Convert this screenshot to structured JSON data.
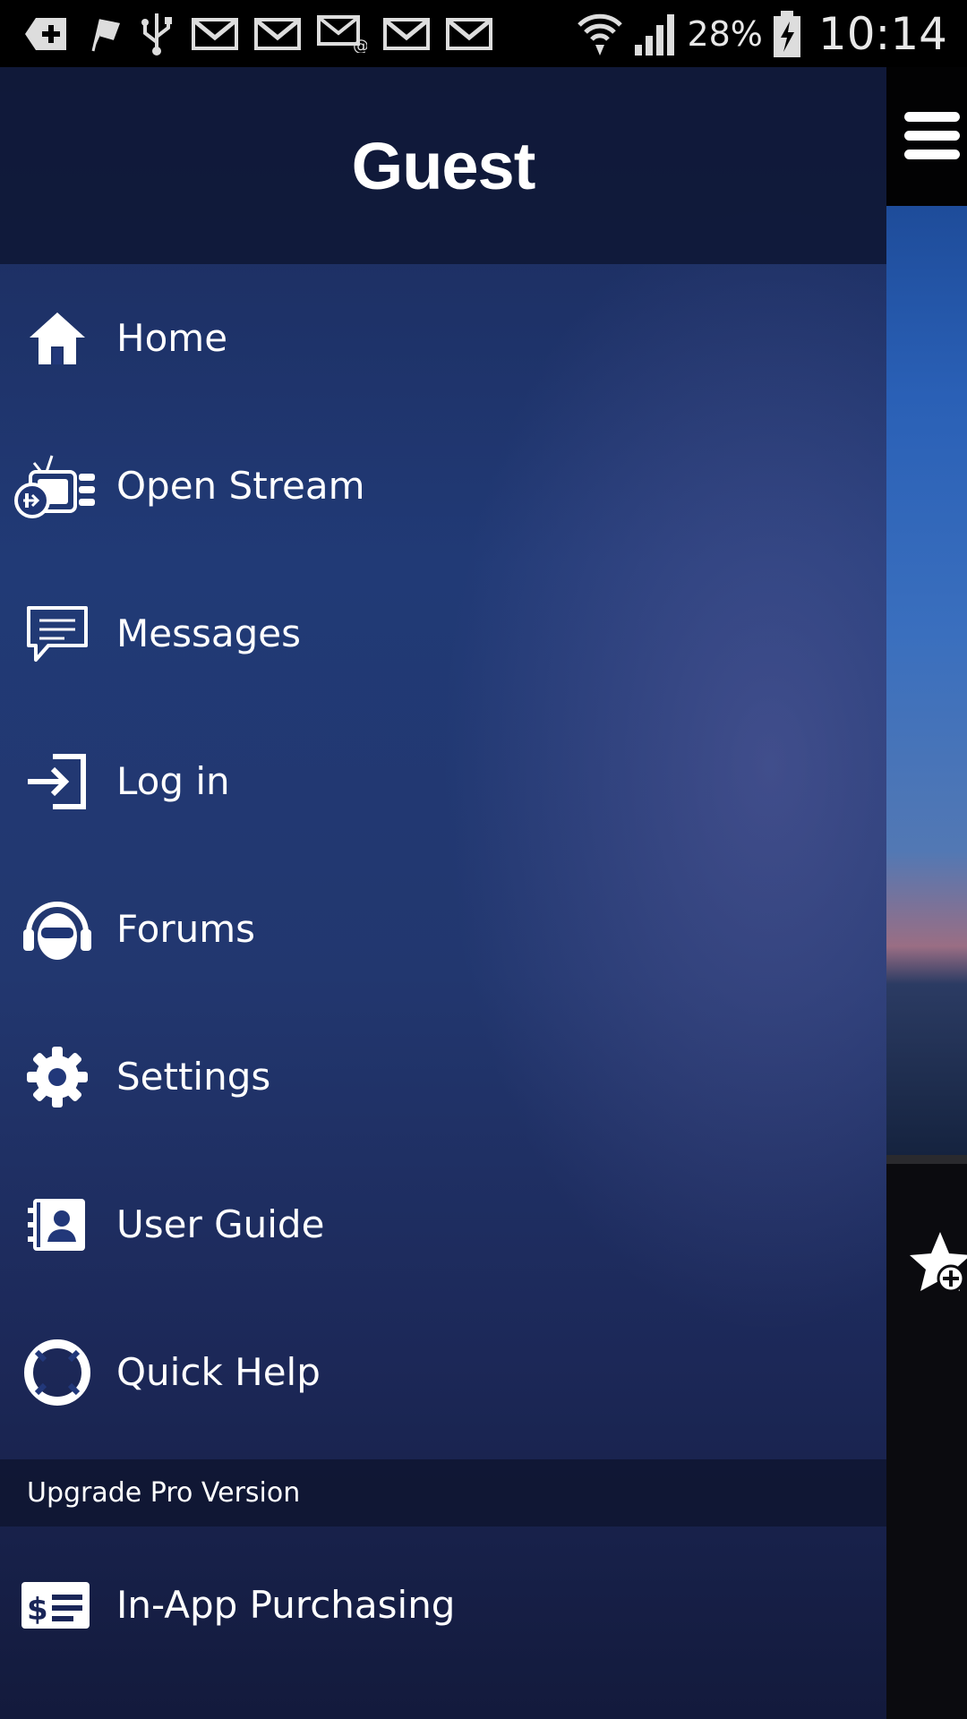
{
  "status_bar": {
    "battery_percent": "28%",
    "time": "10:14",
    "left_icons": [
      "add-notification-icon",
      "flag-icon",
      "usb-icon",
      "gmail-icon",
      "gmail-icon",
      "email-icon",
      "gmail-icon",
      "gmail-icon"
    ],
    "right_icons": [
      "wifi-icon",
      "signal-icon",
      "battery-charging-icon"
    ]
  },
  "drawer": {
    "title": "Guest",
    "items": [
      {
        "label": "Home",
        "icon": "home-icon"
      },
      {
        "label": "Open Stream",
        "icon": "open-stream-icon"
      },
      {
        "label": "Messages",
        "icon": "messages-icon"
      },
      {
        "label": "Log in",
        "icon": "login-icon"
      },
      {
        "label": "Forums",
        "icon": "forums-icon"
      },
      {
        "label": "Settings",
        "icon": "gear-icon"
      },
      {
        "label": "User Guide",
        "icon": "user-guide-icon"
      },
      {
        "label": "Quick Help",
        "icon": "lifebuoy-icon"
      }
    ],
    "section_header": "Upgrade Pro Version",
    "purchase_item": {
      "label": "In-App Purchasing",
      "icon": "purchase-icon"
    }
  },
  "background_app": {
    "menu_icon": "hamburger-icon",
    "favorite_icon": "add-favorite-icon"
  },
  "colors": {
    "drawer_top": "#1b2a5a",
    "drawer_mid": "#213a76",
    "drawer_bottom": "#131a3c",
    "header_bg": "#0e1634",
    "text": "#ffffff"
  }
}
